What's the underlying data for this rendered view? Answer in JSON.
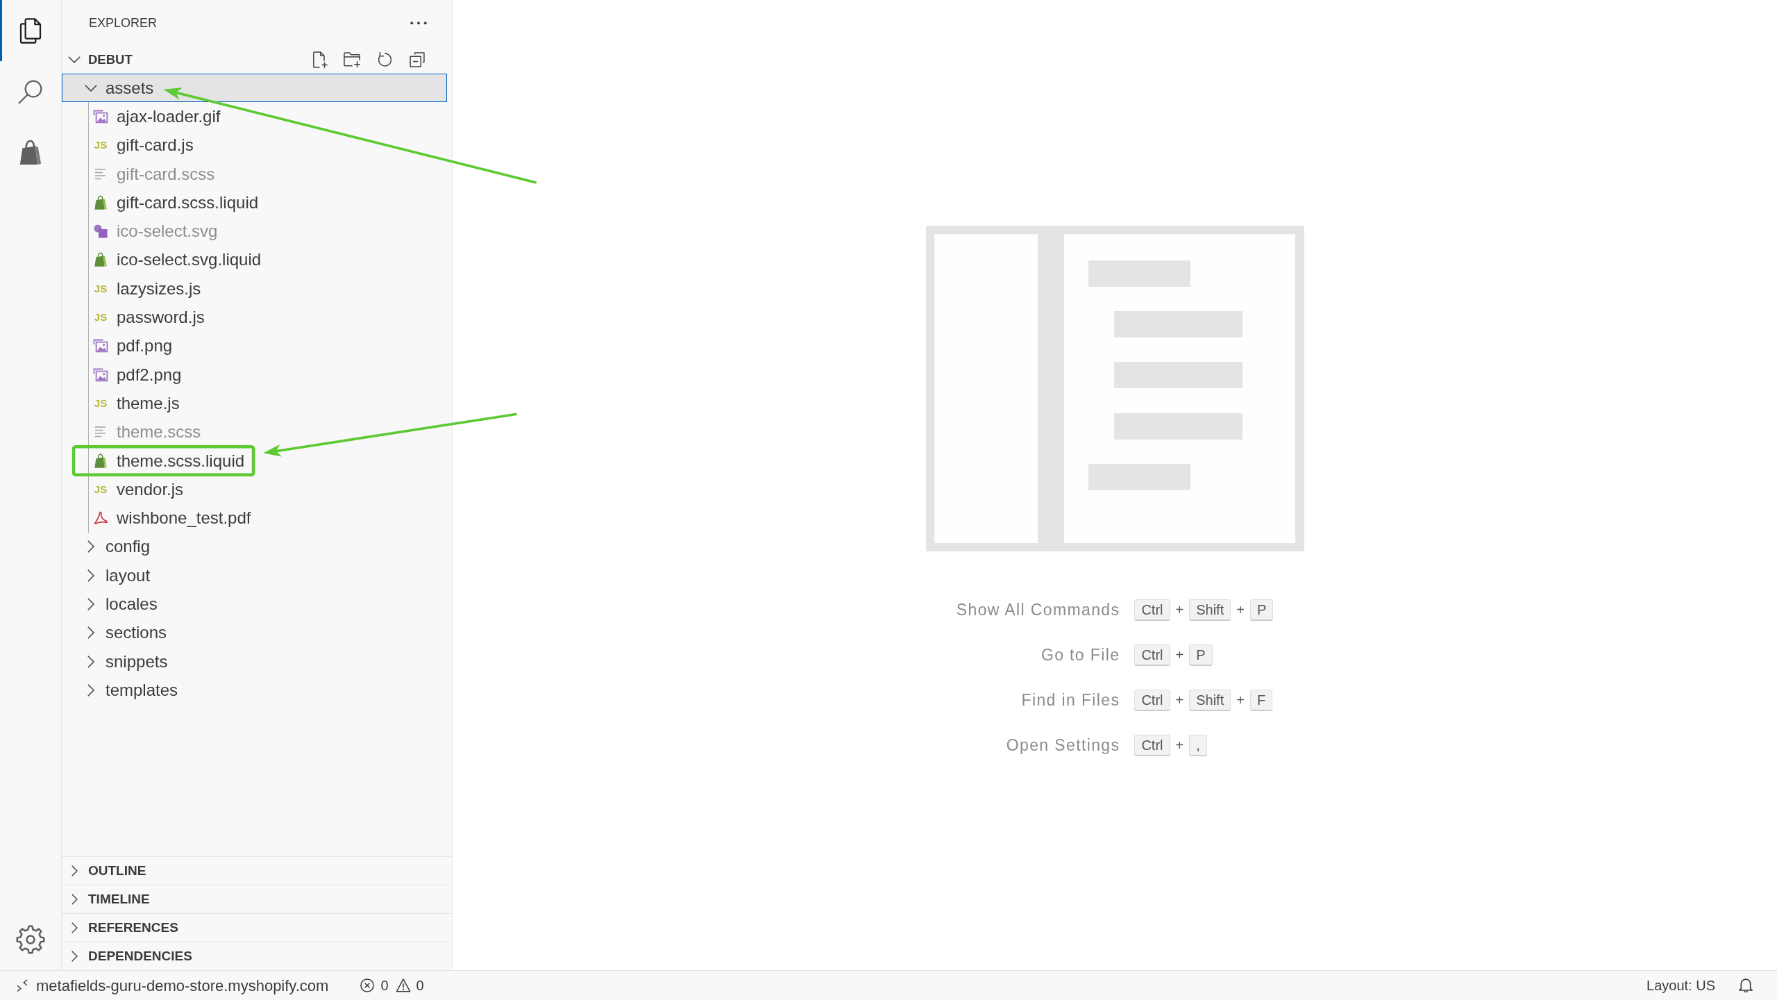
{
  "activity_bar": {
    "items": [
      {
        "kind": "explorer",
        "selected": true
      },
      {
        "kind": "search",
        "selected": false
      },
      {
        "kind": "shopify",
        "selected": false
      }
    ]
  },
  "sidebar": {
    "title": "EXPLORER",
    "workspace": {
      "name": "DEBUT",
      "expanded": true
    },
    "tree": [
      {
        "name": "assets",
        "kind": "folder",
        "expanded": true,
        "selected": true,
        "arrow": true,
        "framed": false,
        "children": [
          {
            "name": "ajax-loader.gif",
            "kind": "image",
            "dimmed": false,
            "selected": false,
            "arrow": false,
            "framed": false
          },
          {
            "name": "gift-card.js",
            "kind": "javascript",
            "icon_text": "JS",
            "dimmed": false,
            "selected": false,
            "arrow": false,
            "framed": false
          },
          {
            "name": "gift-card.scss",
            "kind": "text",
            "dimmed": true,
            "selected": false,
            "arrow": false,
            "framed": false
          },
          {
            "name": "gift-card.scss.liquid",
            "kind": "liquid",
            "dimmed": false,
            "selected": false,
            "arrow": false,
            "framed": false
          },
          {
            "name": "ico-select.svg",
            "kind": "svg",
            "dimmed": true,
            "selected": false,
            "arrow": false,
            "framed": false
          },
          {
            "name": "ico-select.svg.liquid",
            "kind": "liquid",
            "dimmed": false,
            "selected": false,
            "arrow": false,
            "framed": false
          },
          {
            "name": "lazysizes.js",
            "kind": "javascript",
            "icon_text": "JS",
            "dimmed": false,
            "selected": false,
            "arrow": false,
            "framed": false
          },
          {
            "name": "password.js",
            "kind": "javascript",
            "icon_text": "JS",
            "dimmed": false,
            "selected": false,
            "arrow": false,
            "framed": false
          },
          {
            "name": "pdf.png",
            "kind": "image",
            "dimmed": false,
            "selected": false,
            "arrow": false,
            "framed": false
          },
          {
            "name": "pdf2.png",
            "kind": "image",
            "dimmed": false,
            "selected": false,
            "arrow": false,
            "framed": false
          },
          {
            "name": "theme.js",
            "kind": "javascript",
            "icon_text": "JS",
            "dimmed": false,
            "selected": false,
            "arrow": false,
            "framed": false
          },
          {
            "name": "theme.scss",
            "kind": "text",
            "dimmed": true,
            "selected": false,
            "arrow": false,
            "framed": false
          },
          {
            "name": "theme.scss.liquid",
            "kind": "liquid",
            "dimmed": false,
            "selected": false,
            "arrow": true,
            "framed": true
          },
          {
            "name": "vendor.js",
            "kind": "javascript",
            "icon_text": "JS",
            "dimmed": false,
            "selected": false,
            "arrow": false,
            "framed": false
          },
          {
            "name": "wishbone_test.pdf",
            "kind": "pdf",
            "dimmed": false,
            "selected": false,
            "arrow": false,
            "framed": false
          }
        ]
      },
      {
        "name": "config",
        "kind": "folder",
        "expanded": false,
        "selected": false,
        "arrow": false,
        "framed": false
      },
      {
        "name": "layout",
        "kind": "folder",
        "expanded": false,
        "selected": false,
        "arrow": false,
        "framed": false
      },
      {
        "name": "locales",
        "kind": "folder",
        "expanded": false,
        "selected": false,
        "arrow": false,
        "framed": false
      },
      {
        "name": "sections",
        "kind": "folder",
        "expanded": false,
        "selected": false,
        "arrow": false,
        "framed": false
      },
      {
        "name": "snippets",
        "kind": "folder",
        "expanded": false,
        "selected": false,
        "arrow": false,
        "framed": false
      },
      {
        "name": "templates",
        "kind": "folder",
        "expanded": false,
        "selected": false,
        "arrow": false,
        "framed": false
      }
    ],
    "panels": [
      {
        "title": "OUTLINE",
        "expanded": false
      },
      {
        "title": "TIMELINE",
        "expanded": false
      },
      {
        "title": "REFERENCES",
        "expanded": false
      },
      {
        "title": "DEPENDENCIES",
        "expanded": false
      }
    ]
  },
  "editor": {
    "shortcuts": [
      {
        "label": "Show All Commands",
        "keys": [
          {
            "kind": "key",
            "text": "Ctrl"
          },
          {
            "kind": "plus",
            "text": "+"
          },
          {
            "kind": "key",
            "text": "Shift"
          },
          {
            "kind": "plus",
            "text": "+"
          },
          {
            "kind": "key",
            "text": "P"
          }
        ]
      },
      {
        "label": "Go to File",
        "keys": [
          {
            "kind": "key",
            "text": "Ctrl"
          },
          {
            "kind": "plus",
            "text": "+"
          },
          {
            "kind": "key",
            "text": "P"
          }
        ]
      },
      {
        "label": "Find in Files",
        "keys": [
          {
            "kind": "key",
            "text": "Ctrl"
          },
          {
            "kind": "plus",
            "text": "+"
          },
          {
            "kind": "key",
            "text": "Shift"
          },
          {
            "kind": "plus",
            "text": "+"
          },
          {
            "kind": "key",
            "text": "F"
          }
        ]
      },
      {
        "label": "Open Settings",
        "keys": [
          {
            "kind": "key",
            "text": "Ctrl"
          },
          {
            "kind": "plus",
            "text": "+"
          },
          {
            "kind": "key",
            "text": ","
          }
        ]
      }
    ]
  },
  "status_bar": {
    "remote": "metafields-guru-demo-store.myshopify.com",
    "errors": "0",
    "warnings": "0",
    "keyboard_layout": "Layout: US"
  }
}
